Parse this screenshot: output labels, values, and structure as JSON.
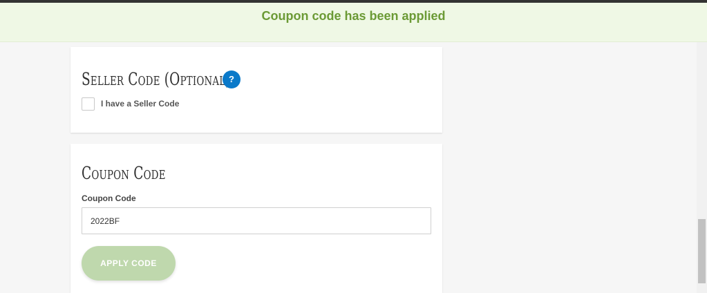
{
  "notice": {
    "message": "Coupon code has been applied",
    "background_color": "#eff8e5",
    "text_color": "#6b9a35"
  },
  "seller_section": {
    "title": "Seller Code (Optional)",
    "help_label": "?",
    "help_icon": "question-mark-icon",
    "help_color": "#0a79c9",
    "checkbox_label": "I have a Seller Code",
    "checkbox_checked": false
  },
  "coupon_section": {
    "title": "Coupon Code",
    "field_label": "Coupon Code",
    "field_value": "2022BF",
    "apply_button_label": "APPLY CODE",
    "apply_button_color": "#bfd8ad"
  }
}
